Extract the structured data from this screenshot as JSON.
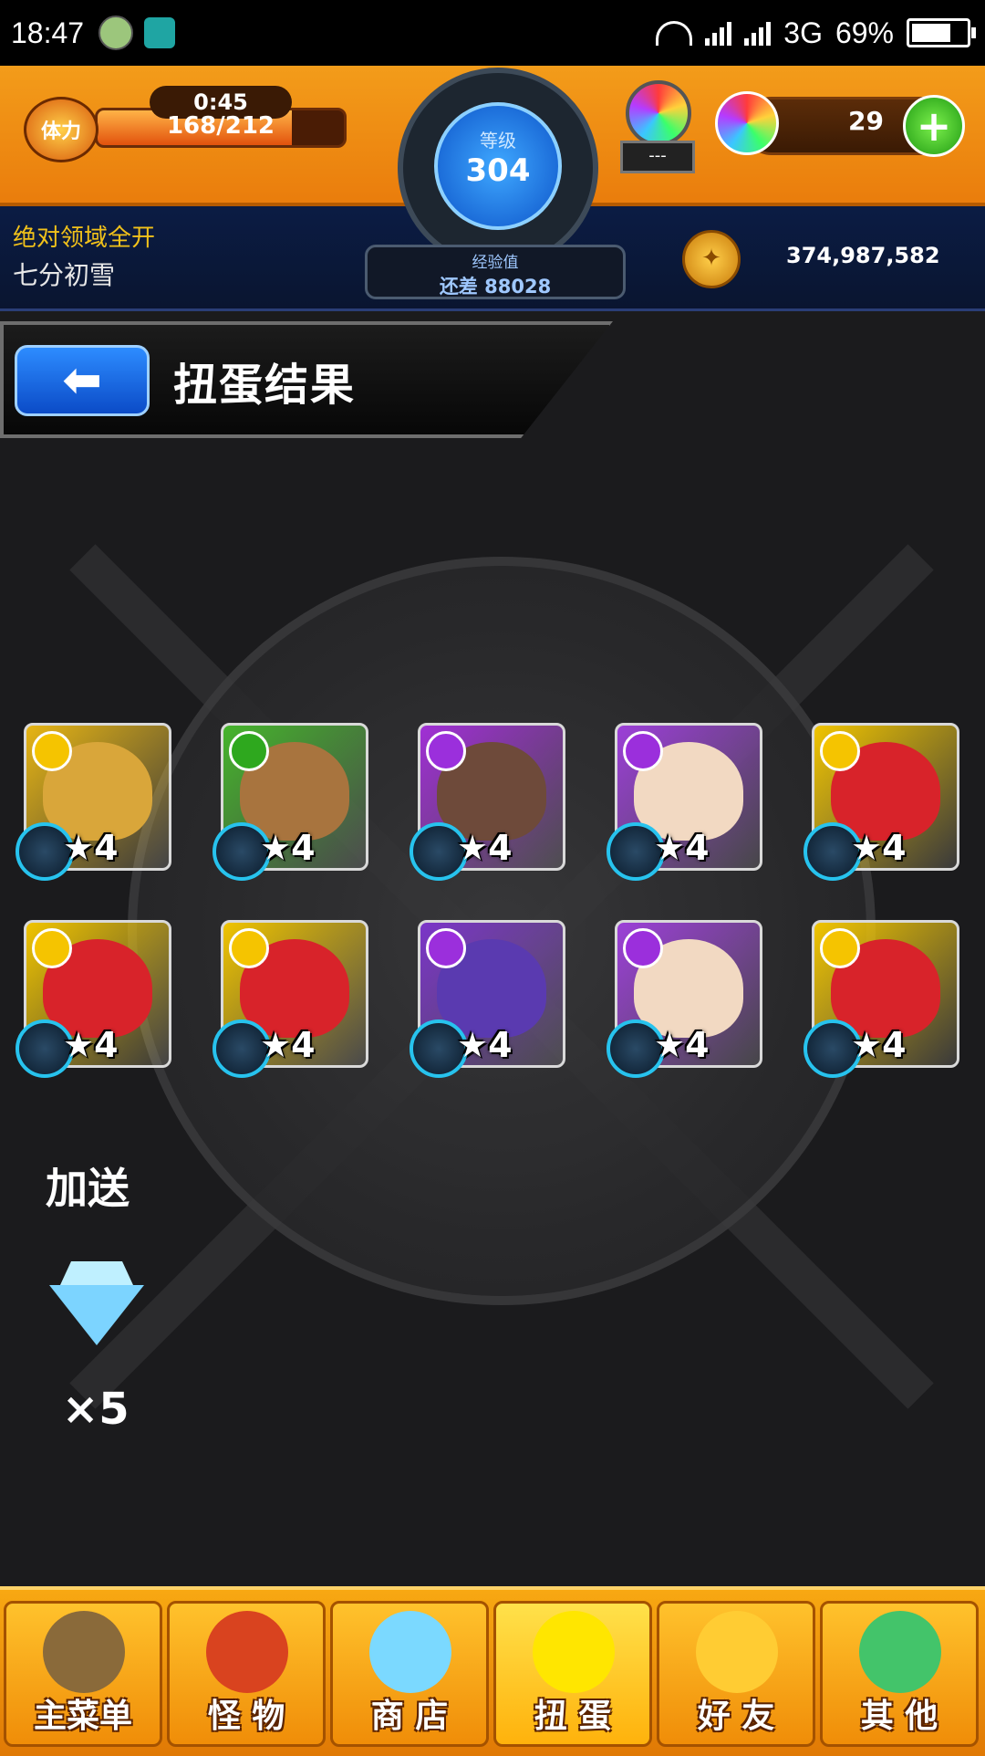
{
  "status_bar": {
    "time": "18:47",
    "network": "3G",
    "battery": "69%"
  },
  "hud": {
    "stamina_label": "体力",
    "stamina_timer": "0:45",
    "stamina_value": "168/212",
    "stamina_fraction": 0.79,
    "level_label": "等级",
    "level_value": "304",
    "exp_label": "经验值",
    "exp_remaining": "还差 88028",
    "orb_shop_display": "---",
    "orb_count": "29",
    "player_title": "绝对领域全开",
    "player_name": "七分初雪",
    "gold": "374,987,582"
  },
  "header": {
    "title": "扭蛋结果"
  },
  "results": [
    {
      "rarity": "★4",
      "bg": "#e7b514",
      "attr": "#f5c400",
      "face": "#d9a63a"
    },
    {
      "rarity": "★4",
      "bg": "#46b52c",
      "attr": "#2ea81e",
      "face": "#a8743e"
    },
    {
      "rarity": "★4",
      "bg": "#a12fd6",
      "attr": "#9b2fdc",
      "face": "#6e4a3a"
    },
    {
      "rarity": "★4",
      "bg": "#9c3fd8",
      "attr": "#9b2fdc",
      "face": "#f2d9c2"
    },
    {
      "rarity": "★4",
      "bg": "#f0c400",
      "attr": "#f5c400",
      "face": "#d8232a"
    },
    {
      "rarity": "★4",
      "bg": "#f0c400",
      "attr": "#f5c400",
      "face": "#d8232a"
    },
    {
      "rarity": "★4",
      "bg": "#f0c400",
      "attr": "#f5c400",
      "face": "#d8232a"
    },
    {
      "rarity": "★4",
      "bg": "#7b35c9",
      "attr": "#9b2fdc",
      "face": "#5a3ab0"
    },
    {
      "rarity": "★4",
      "bg": "#9c3fd8",
      "attr": "#9b2fdc",
      "face": "#f2d9c2"
    },
    {
      "rarity": "★4",
      "bg": "#f0c400",
      "attr": "#f5c400",
      "face": "#d8232a"
    }
  ],
  "bonus": {
    "label": "加送",
    "count": "×5",
    "icon": "diamond-icon"
  },
  "nav": [
    {
      "label": "主菜单",
      "icon": "castle-gate-icon",
      "color": "#8a6a3a"
    },
    {
      "label": "怪 物",
      "icon": "dragon-icon",
      "color": "#d9431f"
    },
    {
      "label": "商 店",
      "icon": "rainbow-orb-icon",
      "color": "#7bd9ff"
    },
    {
      "label": "扭 蛋",
      "icon": "egg-icon",
      "color": "#ffe600"
    },
    {
      "label": "好 友",
      "icon": "friends-icon",
      "color": "#ffcc33"
    },
    {
      "label": "其 他",
      "icon": "question-icon",
      "color": "#43c46a"
    }
  ]
}
